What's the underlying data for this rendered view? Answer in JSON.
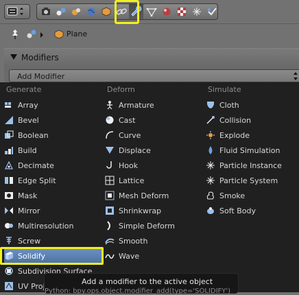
{
  "breadcrumb": {
    "object_name": "Plane"
  },
  "panel": {
    "title": "Modifiers",
    "add_modifier_label": "Add Modifier"
  },
  "menu": {
    "columns": [
      {
        "title": "Generate",
        "items": [
          {
            "label": "Array",
            "icon": "array-icon"
          },
          {
            "label": "Bevel",
            "icon": "bevel-icon"
          },
          {
            "label": "Boolean",
            "icon": "boolean-icon"
          },
          {
            "label": "Build",
            "icon": "build-icon"
          },
          {
            "label": "Decimate",
            "icon": "decimate-icon"
          },
          {
            "label": "Edge Split",
            "icon": "edge-split-icon"
          },
          {
            "label": "Mask",
            "icon": "mask-icon"
          },
          {
            "label": "Mirror",
            "icon": "mirror-icon"
          },
          {
            "label": "Multiresolution",
            "icon": "multires-icon"
          },
          {
            "label": "Screw",
            "icon": "screw-icon"
          },
          {
            "label": "Solidify",
            "icon": "solidify-icon"
          },
          {
            "label": "Subdivision Surface",
            "icon": "subsurf-icon"
          },
          {
            "label": "UV Proje",
            "icon": "uv-project-icon"
          }
        ]
      },
      {
        "title": "Deform",
        "items": [
          {
            "label": "Armature",
            "icon": "armature-icon"
          },
          {
            "label": "Cast",
            "icon": "cast-icon"
          },
          {
            "label": "Curve",
            "icon": "curve-icon"
          },
          {
            "label": "Displace",
            "icon": "displace-icon"
          },
          {
            "label": "Hook",
            "icon": "hook-icon"
          },
          {
            "label": "Lattice",
            "icon": "lattice-icon"
          },
          {
            "label": "Mesh Deform",
            "icon": "mesh-deform-icon"
          },
          {
            "label": "Shrinkwrap",
            "icon": "shrinkwrap-icon"
          },
          {
            "label": "Simple Deform",
            "icon": "simple-deform-icon"
          },
          {
            "label": "Smooth",
            "icon": "smooth-icon"
          },
          {
            "label": "Wave",
            "icon": "wave-icon"
          }
        ]
      },
      {
        "title": "Simulate",
        "items": [
          {
            "label": "Cloth",
            "icon": "cloth-icon"
          },
          {
            "label": "Collision",
            "icon": "collision-icon"
          },
          {
            "label": "Explode",
            "icon": "explode-icon"
          },
          {
            "label": "Fluid Simulation",
            "icon": "fluid-icon"
          },
          {
            "label": "Particle Instance",
            "icon": "particle-instance-icon"
          },
          {
            "label": "Particle System",
            "icon": "particle-system-icon"
          },
          {
            "label": "Smoke",
            "icon": "smoke-icon"
          },
          {
            "label": "Soft Body",
            "icon": "soft-body-icon"
          }
        ]
      }
    ],
    "selected": "Solidify"
  },
  "tooltip": {
    "title": "Add a modifier to the active object",
    "python": "Python: bpy.ops.object.modifier_add(type='SOLIDIFY')"
  },
  "colors": {
    "highlight": "#f3f01b",
    "selected_row": "#5a7fb2",
    "menu_bg": "#202020"
  }
}
